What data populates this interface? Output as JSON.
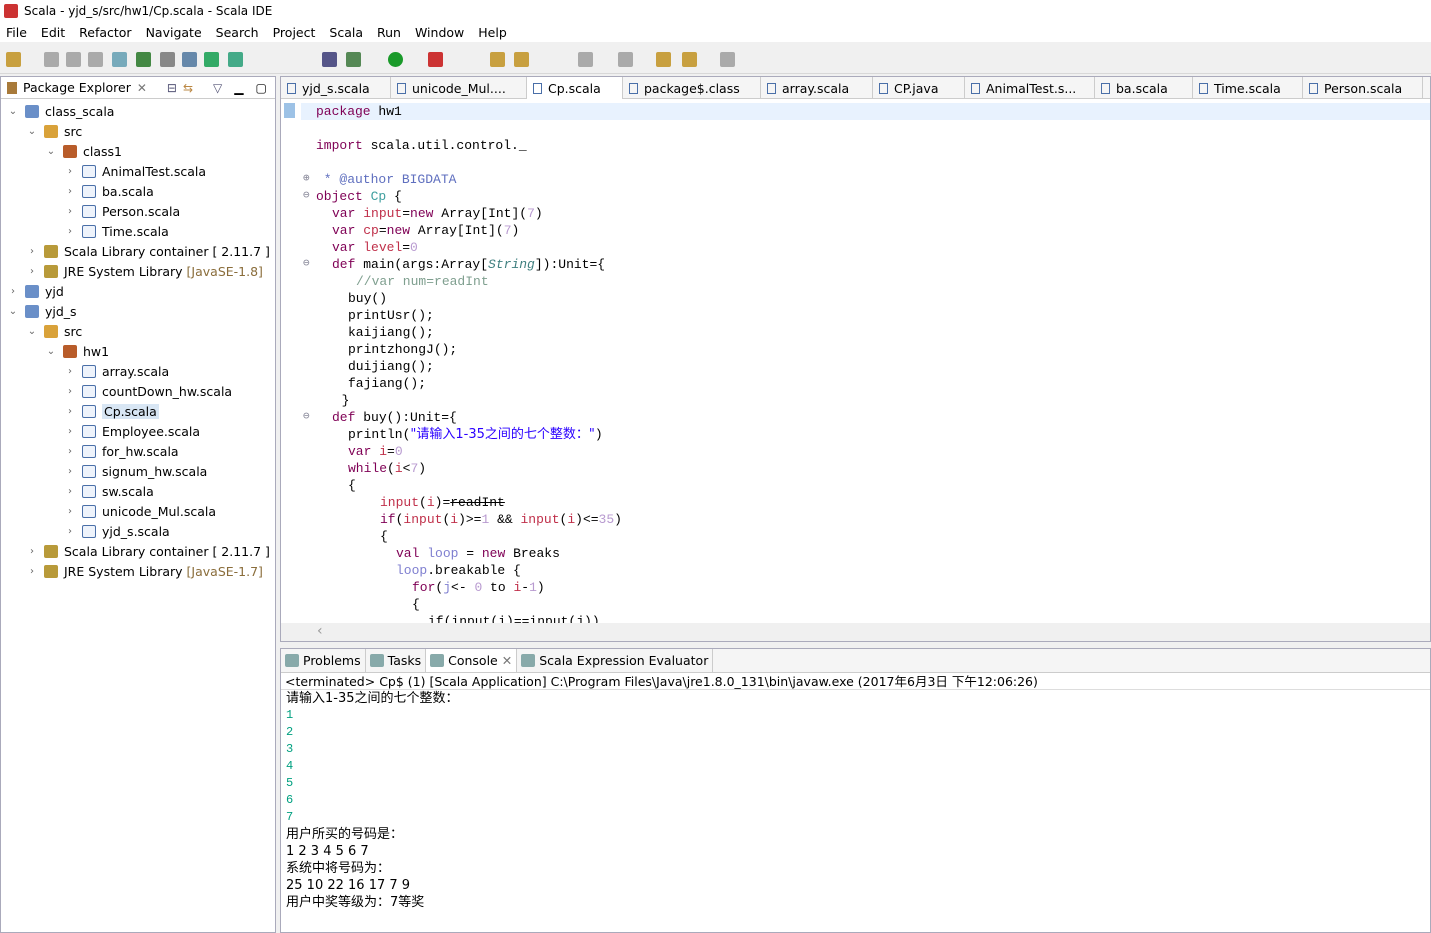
{
  "window": {
    "title": "Scala - yjd_s/src/hw1/Cp.scala - Scala IDE"
  },
  "menu": [
    "File",
    "Edit",
    "Refactor",
    "Navigate",
    "Search",
    "Project",
    "Scala",
    "Run",
    "Window",
    "Help"
  ],
  "package_explorer": {
    "title": "Package Explorer",
    "tree": [
      {
        "level": 0,
        "arrow": "v",
        "icon": "proj",
        "label": "class_scala"
      },
      {
        "level": 1,
        "arrow": "v",
        "icon": "src",
        "label": "src"
      },
      {
        "level": 2,
        "arrow": "v",
        "icon": "pkg",
        "label": "class1"
      },
      {
        "level": 3,
        "arrow": ">",
        "icon": "file",
        "label": "AnimalTest.scala"
      },
      {
        "level": 3,
        "arrow": ">",
        "icon": "file",
        "label": "ba.scala"
      },
      {
        "level": 3,
        "arrow": ">",
        "icon": "file",
        "label": "Person.scala"
      },
      {
        "level": 3,
        "arrow": ">",
        "icon": "file",
        "label": "Time.scala"
      },
      {
        "level": 1,
        "arrow": ">",
        "icon": "lib",
        "label": "Scala Library container [ 2.11.7 ]"
      },
      {
        "level": 1,
        "arrow": ">",
        "icon": "lib",
        "label": "JRE System Library",
        "extra": "[JavaSE-1.8]"
      },
      {
        "level": 0,
        "arrow": ">",
        "icon": "proj",
        "label": "yjd"
      },
      {
        "level": 0,
        "arrow": "v",
        "icon": "proj",
        "label": "yjd_s"
      },
      {
        "level": 1,
        "arrow": "v",
        "icon": "src",
        "label": "src"
      },
      {
        "level": 2,
        "arrow": "v",
        "icon": "pkg",
        "label": "hw1"
      },
      {
        "level": 3,
        "arrow": ">",
        "icon": "file",
        "label": "array.scala"
      },
      {
        "level": 3,
        "arrow": ">",
        "icon": "file",
        "label": "countDown_hw.scala"
      },
      {
        "level": 3,
        "arrow": ">",
        "icon": "file",
        "label": "Cp.scala",
        "selected": true
      },
      {
        "level": 3,
        "arrow": ">",
        "icon": "file",
        "label": "Employee.scala"
      },
      {
        "level": 3,
        "arrow": ">",
        "icon": "file",
        "label": "for_hw.scala"
      },
      {
        "level": 3,
        "arrow": ">",
        "icon": "file",
        "label": "signum_hw.scala"
      },
      {
        "level": 3,
        "arrow": ">",
        "icon": "file",
        "label": "sw.scala"
      },
      {
        "level": 3,
        "arrow": ">",
        "icon": "file",
        "label": "unicode_Mul.scala"
      },
      {
        "level": 3,
        "arrow": ">",
        "icon": "file",
        "label": "yjd_s.scala"
      },
      {
        "level": 1,
        "arrow": ">",
        "icon": "lib",
        "label": "Scala Library container [ 2.11.7 ]"
      },
      {
        "level": 1,
        "arrow": ">",
        "icon": "lib",
        "label": "JRE System Library",
        "extra": "[JavaSE-1.7]"
      }
    ]
  },
  "editor": {
    "tabs": [
      "yjd_s.scala",
      "unicode_Mul....",
      "Cp.scala",
      "package$.class",
      "array.scala",
      "CP.java",
      "AnimalTest.s...",
      "ba.scala",
      "Time.scala",
      "Person.scala"
    ],
    "active_tab": "Cp.scala",
    "lines": [
      {
        "n": 0,
        "i": 0,
        "t": [
          [
            "package ",
            "kw"
          ],
          [
            "hw1",
            ""
          ]
        ]
      },
      {
        "n": 2,
        "i": 0,
        "t": [
          [
            "import ",
            "kw"
          ],
          [
            "scala.util.control._",
            ""
          ]
        ]
      },
      {
        "n": 4,
        "i": 0,
        "t": [
          [
            " * ",
            "dc"
          ],
          [
            "@author BIGDATA",
            "dc"
          ]
        ]
      },
      {
        "n": 5,
        "i": 0,
        "t": [
          [
            "object ",
            "kw"
          ],
          [
            "Cp",
            "ob"
          ],
          [
            " {",
            ""
          ]
        ]
      },
      {
        "n": 6,
        "i": 1,
        "t": [
          [
            "var ",
            "kw"
          ],
          [
            "input",
            "vr"
          ],
          [
            "=",
            ""
          ],
          [
            "new ",
            "kw"
          ],
          [
            "Array[Int](",
            ""
          ],
          [
            "7",
            "nm"
          ],
          [
            ")",
            ""
          ]
        ]
      },
      {
        "n": 7,
        "i": 1,
        "t": [
          [
            "var ",
            "kw"
          ],
          [
            "cp",
            "vr"
          ],
          [
            "=",
            ""
          ],
          [
            "new ",
            "kw"
          ],
          [
            "Array[Int](",
            ""
          ],
          [
            "7",
            "nm"
          ],
          [
            ")",
            ""
          ]
        ]
      },
      {
        "n": 8,
        "i": 1,
        "t": [
          [
            "var ",
            "kw"
          ],
          [
            "level",
            "vr"
          ],
          [
            "=",
            ""
          ],
          [
            "0",
            "nm"
          ]
        ]
      },
      {
        "n": 9,
        "i": 1,
        "t": [
          [
            "def ",
            "kw"
          ],
          [
            "main(args:Array[",
            ""
          ],
          [
            "String",
            "ty"
          ],
          [
            "]):Unit={",
            ""
          ]
        ]
      },
      {
        "n": 10,
        "i": 2.5,
        "t": [
          [
            "//var num=readInt",
            "cm"
          ]
        ]
      },
      {
        "n": 11,
        "i": 2,
        "t": [
          [
            "buy()",
            ""
          ]
        ]
      },
      {
        "n": 12,
        "i": 2,
        "t": [
          [
            "printUsr();",
            ""
          ]
        ]
      },
      {
        "n": 13,
        "i": 2,
        "t": [
          [
            "kaijiang();",
            ""
          ]
        ]
      },
      {
        "n": 14,
        "i": 2,
        "t": [
          [
            "printzhongJ();",
            ""
          ]
        ]
      },
      {
        "n": 15,
        "i": 2,
        "t": [
          [
            "duijiang();",
            ""
          ]
        ]
      },
      {
        "n": 16,
        "i": 2,
        "t": [
          [
            "fajiang();",
            ""
          ]
        ]
      },
      {
        "n": 17,
        "i": 1.6,
        "t": [
          [
            "}",
            ""
          ]
        ]
      },
      {
        "n": 18,
        "i": 1,
        "t": [
          [
            "def ",
            "kw"
          ],
          [
            "buy():Unit={",
            ""
          ]
        ]
      },
      {
        "n": 19,
        "i": 2,
        "t": [
          [
            "println(",
            ""
          ],
          [
            "\"请输入1-35之间的七个整数：\"",
            "st"
          ],
          [
            ")",
            ""
          ]
        ]
      },
      {
        "n": 20,
        "i": 2,
        "t": [
          [
            "var ",
            "kw"
          ],
          [
            "i",
            "vr"
          ],
          [
            "=",
            ""
          ],
          [
            "0",
            "nm"
          ]
        ]
      },
      {
        "n": 21,
        "i": 2,
        "t": [
          [
            "while",
            "kw"
          ],
          [
            "(",
            ""
          ],
          [
            "i",
            "vr"
          ],
          [
            "<",
            ""
          ],
          [
            "7",
            "nm"
          ],
          [
            ")",
            ""
          ]
        ]
      },
      {
        "n": 22,
        "i": 2,
        "t": [
          [
            "{",
            ""
          ]
        ]
      },
      {
        "n": 23,
        "i": 4,
        "t": [
          [
            "input",
            "vr"
          ],
          [
            "(",
            ""
          ],
          [
            "i",
            "vr"
          ],
          [
            ")=",
            ""
          ],
          [
            "readInt",
            "so"
          ]
        ]
      },
      {
        "n": 24,
        "i": 4,
        "t": [
          [
            "if",
            "kw"
          ],
          [
            "(",
            ""
          ],
          [
            "input",
            "vr"
          ],
          [
            "(",
            ""
          ],
          [
            "i",
            "vr"
          ],
          [
            ")>=",
            ""
          ],
          [
            "1",
            "nm"
          ],
          [
            " && ",
            ""
          ],
          [
            "input",
            "vr"
          ],
          [
            "(",
            ""
          ],
          [
            "i",
            "vr"
          ],
          [
            ")<=",
            ""
          ],
          [
            "35",
            "nm"
          ],
          [
            ")",
            ""
          ]
        ]
      },
      {
        "n": 25,
        "i": 4,
        "t": [
          [
            "{",
            ""
          ]
        ]
      },
      {
        "n": 26,
        "i": 5,
        "t": [
          [
            "val ",
            "kw"
          ],
          [
            "loop",
            "lp"
          ],
          [
            " = ",
            ""
          ],
          [
            "new ",
            "kw"
          ],
          [
            "Breaks",
            ""
          ]
        ]
      },
      {
        "n": 27,
        "i": 5,
        "t": [
          [
            "loop",
            "lp"
          ],
          [
            ".breakable {",
            ""
          ]
        ]
      },
      {
        "n": 28,
        "i": 6,
        "t": [
          [
            "for",
            "kw"
          ],
          [
            "(",
            ""
          ],
          [
            "j",
            "lp"
          ],
          [
            "<- ",
            ""
          ],
          [
            "0",
            "nm"
          ],
          [
            " to ",
            ""
          ],
          [
            "i",
            "vr"
          ],
          [
            "-",
            ""
          ],
          [
            "1",
            "nm"
          ],
          [
            ")",
            ""
          ]
        ]
      },
      {
        "n": 29,
        "i": 6,
        "t": [
          [
            "{",
            ""
          ]
        ]
      },
      {
        "n": 30,
        "i": 7,
        "t": [
          [
            "if(input(i)==input(j))",
            ""
          ]
        ]
      }
    ]
  },
  "console": {
    "tabs": [
      "Problems",
      "Tasks",
      "Console",
      "Scala Expression Evaluator"
    ],
    "active_tab": "Console",
    "header": "<terminated> Cp$ (1) [Scala Application] C:\\Program Files\\Java\\jre1.8.0_131\\bin\\javaw.exe (2017年6月3日 下午12:06:26)",
    "output": [
      {
        "text": "请输入1-35之间的七个整数：",
        "input": false
      },
      {
        "text": "1",
        "input": true
      },
      {
        "text": "2",
        "input": true
      },
      {
        "text": "3",
        "input": true
      },
      {
        "text": "4",
        "input": true
      },
      {
        "text": "5",
        "input": true
      },
      {
        "text": "6",
        "input": true
      },
      {
        "text": "7",
        "input": true
      },
      {
        "text": "用户所买的号码是：",
        "input": false
      },
      {
        "text": "1 2 3 4 5 6 7",
        "input": false
      },
      {
        "text": "系统中将号码为：",
        "input": false
      },
      {
        "text": "25 10 22 16 17 7 9",
        "input": false
      },
      {
        "text": "用户中奖等级为：7等奖",
        "input": false
      }
    ]
  }
}
